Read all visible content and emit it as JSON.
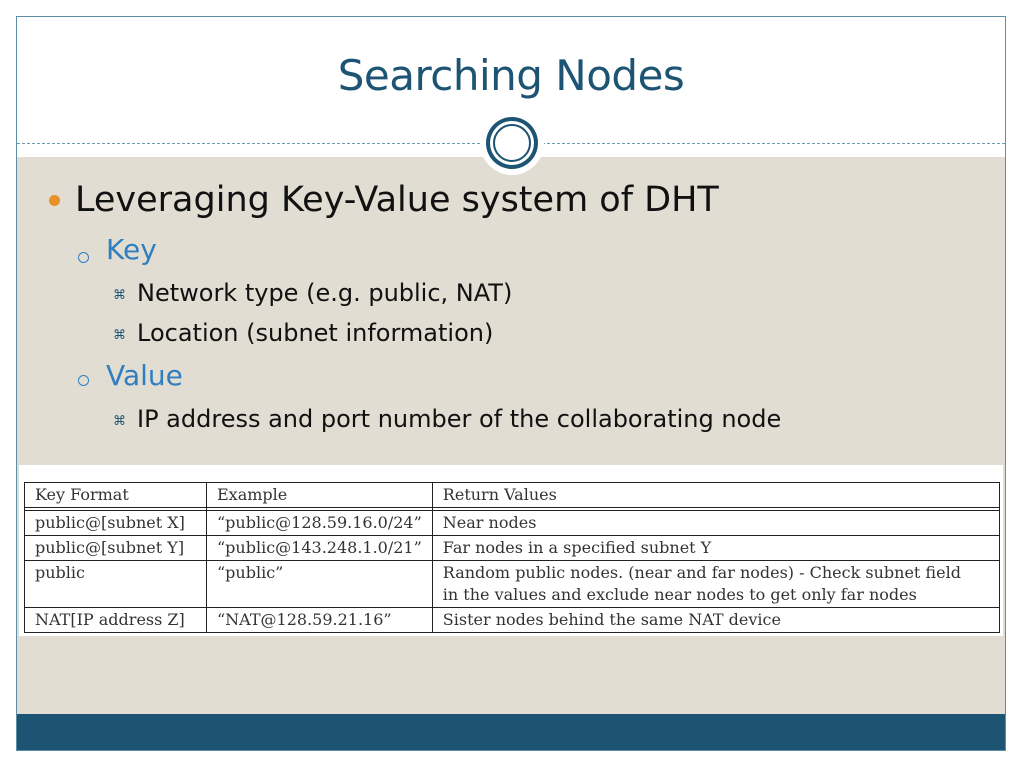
{
  "slide": {
    "title": "Searching Nodes",
    "bullets": {
      "level1": "Leveraging Key-Value system of DHT",
      "key_heading": "Key",
      "key_items": [
        "Network type (e.g. public, NAT)",
        "Location (subnet information)"
      ],
      "value_heading": "Value",
      "value_items": [
        "IP address and port number of the collaborating node"
      ]
    },
    "table": {
      "headers": [
        "Key Format",
        "Example",
        "Return Values"
      ],
      "rows": [
        [
          "public@[subnet X]",
          "“public@128.59.16.0/24”",
          "Near nodes"
        ],
        [
          "public@[subnet Y]",
          "“public@143.248.1.0/21”",
          "Far nodes in a specified subnet Y"
        ],
        [
          "public",
          "“public”",
          "Random public nodes. (near and far nodes) - Check subnet field",
          "in the values and exclude near nodes to get only far nodes"
        ],
        [
          "NAT[IP address Z]",
          "“NAT@128.59.21.16”",
          "Sister nodes behind the same NAT device"
        ]
      ]
    }
  },
  "colors": {
    "title": "#1d5474",
    "accent_orange": "#e8902a",
    "accent_blue": "#2f7fc0",
    "background": "#e2ddd3",
    "footer": "#1d5474"
  },
  "icons": {
    "level1_bullet": "filled-circle-icon",
    "level2_bullet": "hollow-circle-icon",
    "level3_bullet": "bowtie-icon"
  }
}
